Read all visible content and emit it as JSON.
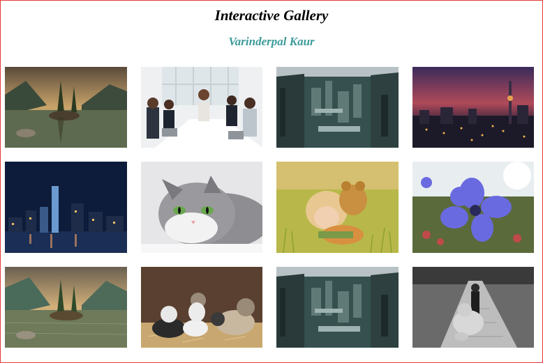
{
  "page": {
    "title": "Interactive Gallery",
    "author": "Varinderpal Kaur",
    "accent_color": "#3e9b9b",
    "border_color": "#e53935"
  },
  "gallery": {
    "images": [
      {
        "subject": "mountain-lake-trees"
      },
      {
        "subject": "business-team-meeting"
      },
      {
        "subject": "city-aerial-skyscrapers"
      },
      {
        "subject": "city-skyline-dusk"
      },
      {
        "subject": "night-city-waterfront"
      },
      {
        "subject": "gray-cat-face"
      },
      {
        "subject": "girl-with-teddy-in-grass"
      },
      {
        "subject": "blue-flower"
      },
      {
        "subject": "mountain-lake-trees-painting"
      },
      {
        "subject": "kittens-in-hay"
      },
      {
        "subject": "city-aerial-skyscrapers"
      },
      {
        "subject": "girl-with-teddy-road-bw"
      }
    ]
  }
}
